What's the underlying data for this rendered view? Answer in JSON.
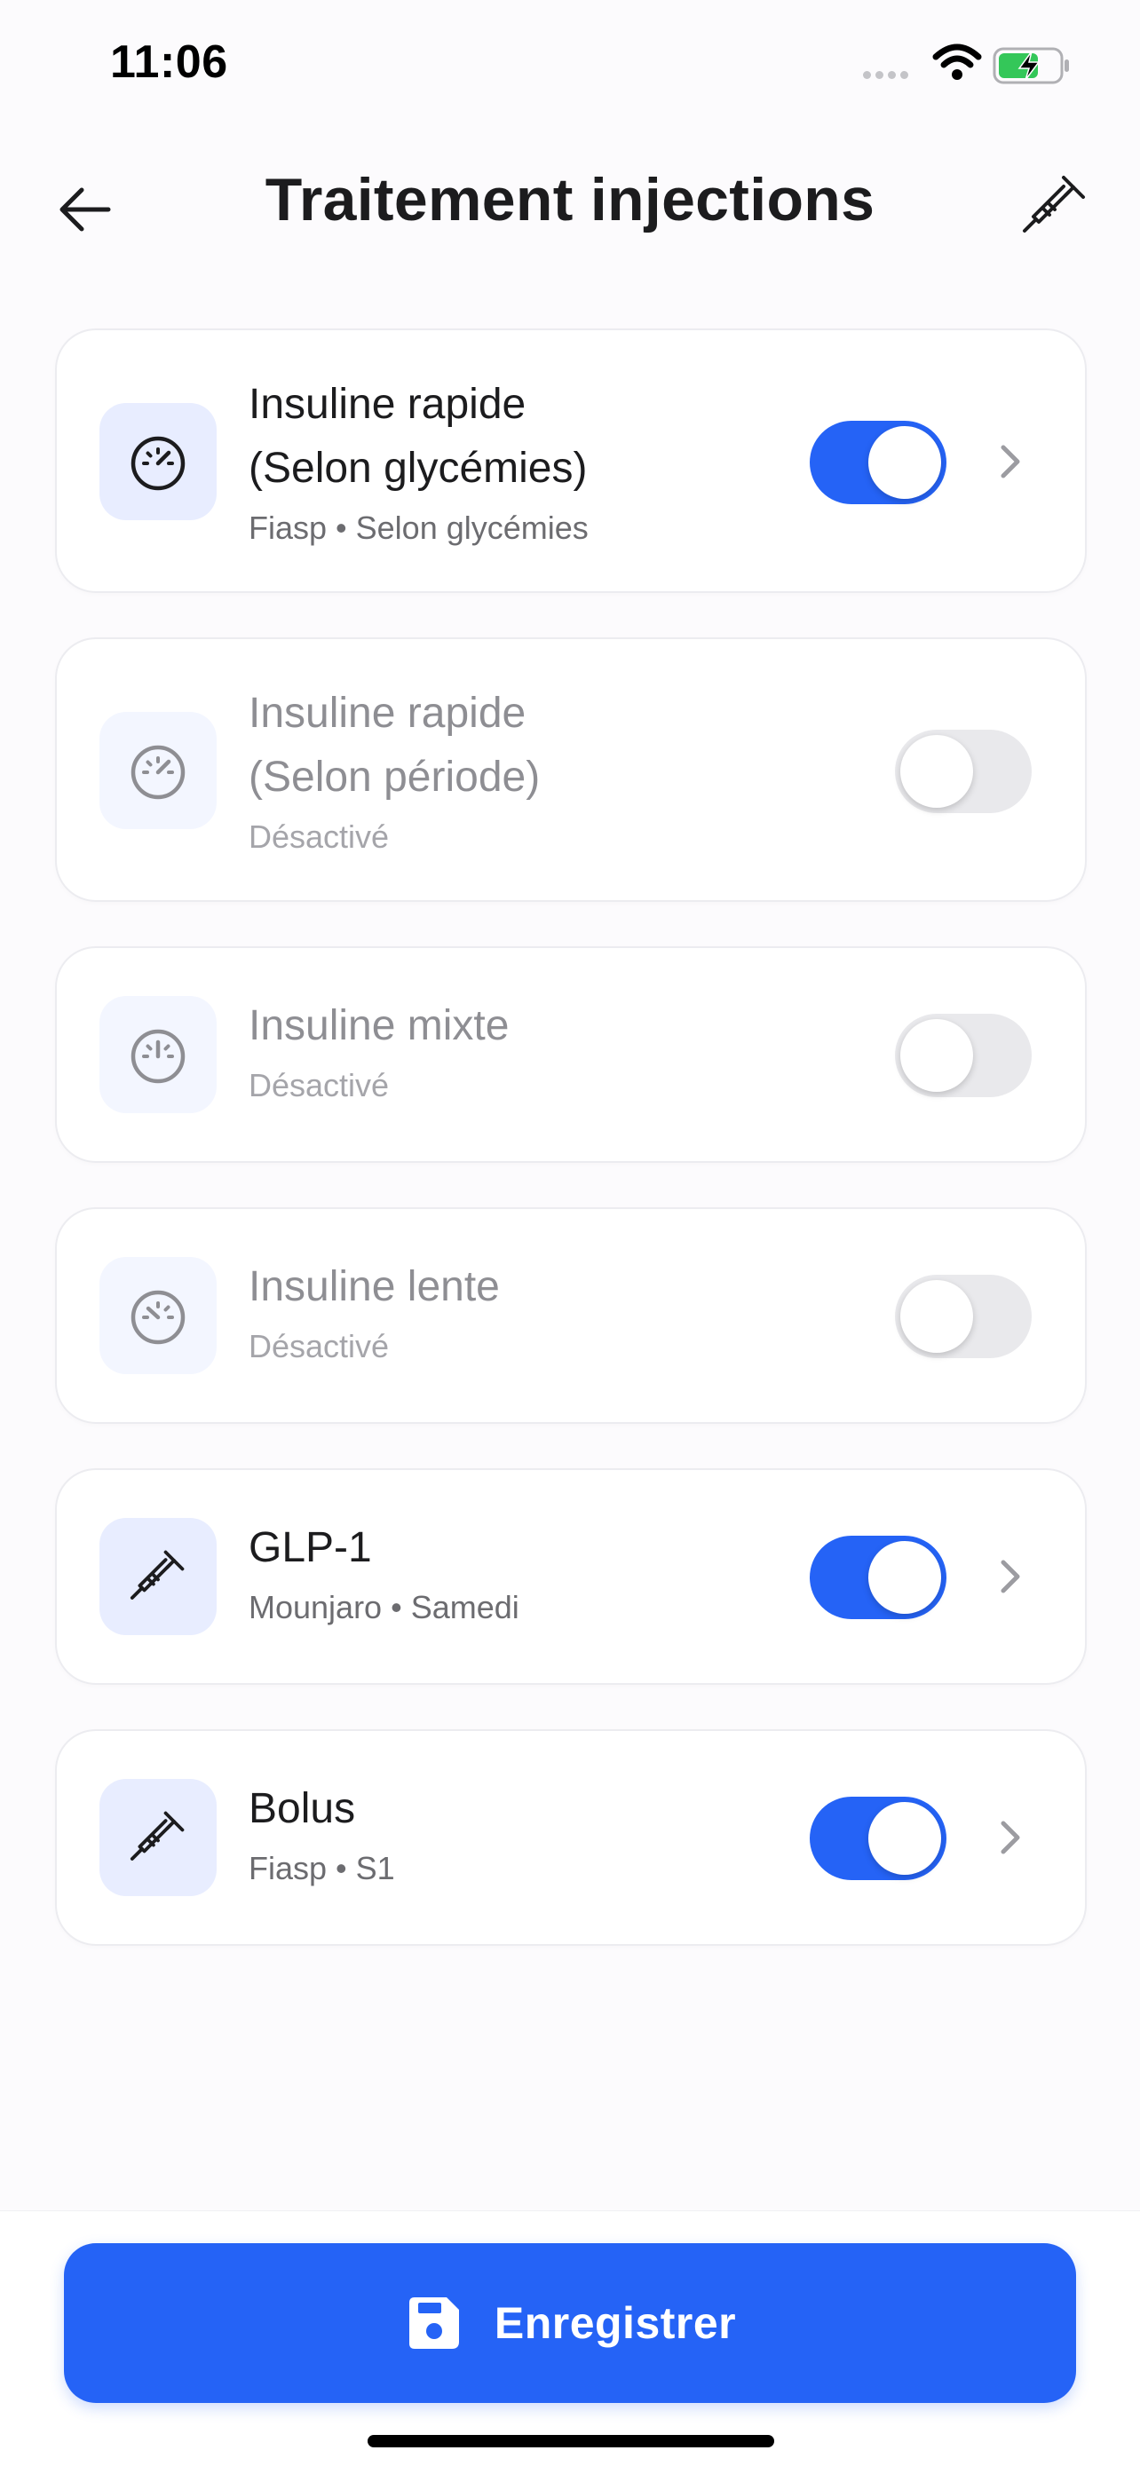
{
  "status_bar": {
    "time": "11:06",
    "signal_icon": "cellular-dots-icon",
    "wifi_icon": "wifi-icon",
    "battery_icon": "battery-charging-icon",
    "battery_color": "#34c759"
  },
  "header": {
    "title": "Traitement injections",
    "back_icon": "arrow-left-icon",
    "action_icon": "syringe-icon"
  },
  "colors": {
    "accent": "#2563f6",
    "icon_bg": "#e8edff",
    "disabled_text": "#8e8e93",
    "toggle_off": "#e9e9ec"
  },
  "cards": [
    {
      "title_line1": "Insuline rapide",
      "title_line2": "(Selon glycémies)",
      "subtitle": "Fiasp  • Selon glycémies",
      "icon": "gauge-icon",
      "enabled": true
    },
    {
      "title_line1": "Insuline rapide",
      "title_line2": "(Selon période)",
      "subtitle": "Désactivé",
      "icon": "gauge-icon",
      "enabled": false
    },
    {
      "title_line1": "Insuline mixte",
      "subtitle": "Désactivé",
      "icon": "gauge-icon",
      "enabled": false
    },
    {
      "title_line1": "Insuline lente",
      "subtitle": "Désactivé",
      "icon": "gauge-icon",
      "enabled": false
    },
    {
      "title_line1": "GLP-1",
      "subtitle": "Mounjaro • Samedi",
      "icon": "syringe-icon",
      "enabled": true
    },
    {
      "title_line1": "Bolus",
      "subtitle": "Fiasp • S1",
      "icon": "syringe-icon",
      "enabled": true
    }
  ],
  "footer": {
    "save_label": "Enregistrer",
    "save_icon": "floppy-disk-icon"
  }
}
